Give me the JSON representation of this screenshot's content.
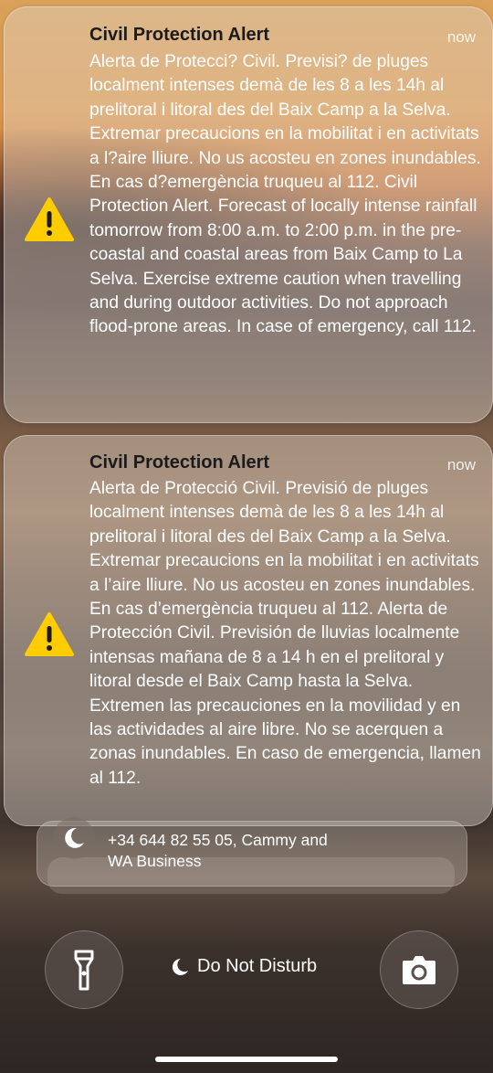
{
  "notifications": [
    {
      "title": "Civil Protection Alert",
      "time": "now",
      "body": "Alerta de Protecci? Civil. Previsi? de pluges localment intenses demà de les 8 a les 14h al prelitoral i litoral des del Baix Camp a la Selva. Extremar precaucions en la mobilitat i en activitats a l?aire lliure. No us acosteu en zones inundables. En cas d?emergència truqueu al 112. Civil Protection Alert. Forecast of locally intense rainfall tomorrow from 8:00 a.m. to 2:00 p.m. in the pre-coastal and coastal areas from Baix Camp to La Selva. Exercise extreme caution when travelling and during outdoor activities. Do not approach flood-prone areas. In case of emergency, call 112.",
      "icon": "warning-icon"
    },
    {
      "title": "Civil Protection Alert",
      "time": "now",
      "body": "Alerta de Protecció Civil. Previsió de pluges localment intenses demà de les 8 a les 14h al prelitoral i litoral des del Baix Camp a la Selva. Extremar precaucions en la mobilitat i en activitats a l’aire lliure. No us acosteu en zones inundables. En cas d’emergència truqueu al 112. Alerta de Protección Civil. Previsión de lluvias localmente intensas mañana de 8 a 14 h en el prelitoral y litoral desde el Baix Camp hasta la Selva. Extremen las precauciones en la movilidad y en las actividades al aire libre. No se acerquen a zonas inundables. En caso de emergencia, llamen al 112.",
      "icon": "warning-icon"
    }
  ],
  "stacked_notification": {
    "text_line1": "+34 644 82 55 05, Cammy and",
    "text_line2": "WA Business",
    "icon": "moon-icon"
  },
  "controls": {
    "flashlight_icon": "flashlight-icon",
    "camera_icon": "camera-icon",
    "focus_label": "Do Not Disturb",
    "focus_icon": "moon-icon"
  },
  "colors": {
    "warning_yellow": "#FFCC00",
    "text_white": "#FFFFFF",
    "title_dark": "#1B1B1D"
  }
}
